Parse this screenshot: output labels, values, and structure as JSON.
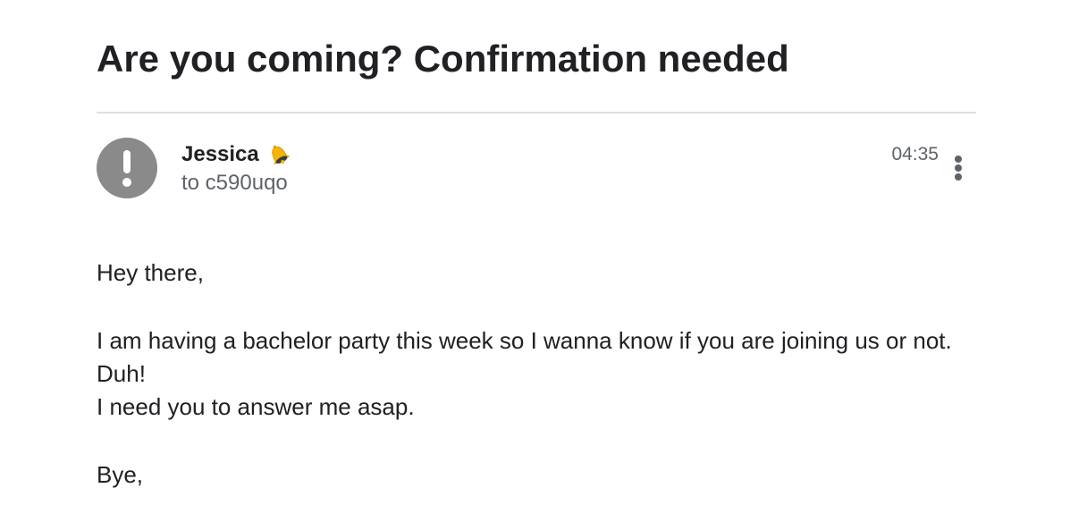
{
  "email": {
    "subject": "Are you coming? Confirmation needed",
    "sender": {
      "name": "Jessica",
      "badge_icon": "bell-icon",
      "avatar_icon": "exclamation-icon",
      "avatar_color": "#8a8a8a"
    },
    "recipient": "to c590uqo",
    "time": "04:35",
    "more_icon": "more-vert-icon",
    "body": {
      "greeting": "Hey there,",
      "lines": [
        "I am having a bachelor party this week so I wanna know if you are joining us or not.",
        "Duh!",
        "I need you to answer me asap."
      ],
      "signoff": "Bye,"
    }
  }
}
